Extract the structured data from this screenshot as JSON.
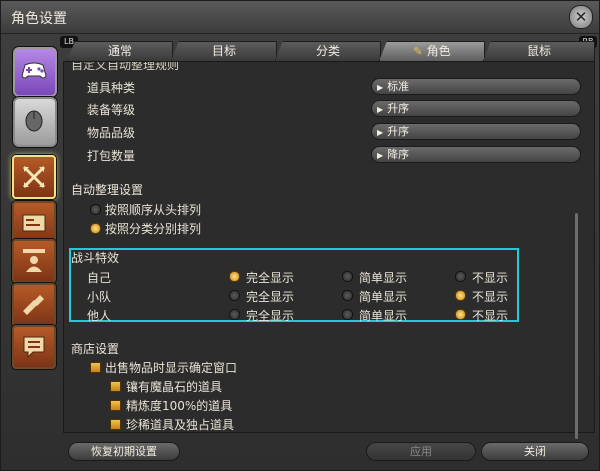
{
  "window": {
    "title": "角色设置",
    "close_icon": "close-x-icon"
  },
  "gamepad_labels": {
    "left": "LB",
    "right": "RB"
  },
  "tabs": [
    {
      "label": "通常",
      "active": false
    },
    {
      "label": "目标",
      "active": false
    },
    {
      "label": "分类",
      "active": false
    },
    {
      "label": "角色",
      "active": true
    },
    {
      "label": "鼠标",
      "active": false
    }
  ],
  "partial_header": "自定义自动整理规则",
  "sort_rules": [
    {
      "label": "道具种类",
      "value": "标准"
    },
    {
      "label": "装备等级",
      "value": "升序"
    },
    {
      "label": "物品品级",
      "value": "升序"
    },
    {
      "label": "打包数量",
      "value": "降序"
    }
  ],
  "auto_sort": {
    "title": "自动整理设置",
    "options": [
      {
        "label": "按照顺序从头排列",
        "selected": false
      },
      {
        "label": "按照分类分别排列",
        "selected": true
      }
    ]
  },
  "battle_effects": {
    "title": "战斗特效",
    "choices": [
      "完全显示",
      "简单显示",
      "不显示"
    ],
    "rows": [
      {
        "label": "自己",
        "selected": 0
      },
      {
        "label": "小队",
        "selected": 2
      },
      {
        "label": "他人",
        "selected": 2
      }
    ]
  },
  "shop": {
    "title": "商店设置",
    "main_option": "出售物品时显示确定窗口",
    "sub_options": [
      "镶有魔晶石的道具",
      "精炼度100%的道具",
      "珍稀道具及独占道具"
    ]
  },
  "footer": {
    "reset": "恢复初期设置",
    "apply": "应用",
    "close": "关闭"
  },
  "highlight_color": "#25c9d4"
}
